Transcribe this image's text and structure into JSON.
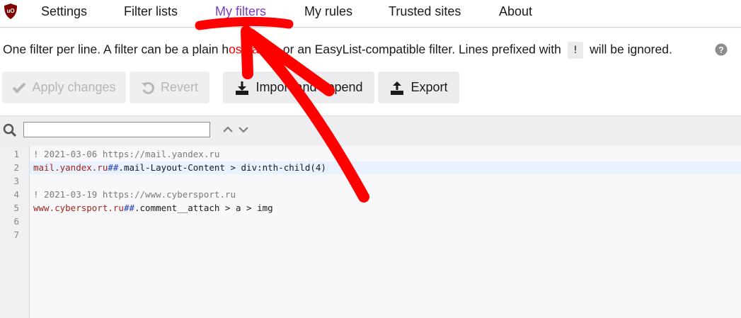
{
  "tabs": [
    {
      "label": "Settings"
    },
    {
      "label": "Filter lists"
    },
    {
      "label": "My filters",
      "active": true
    },
    {
      "label": "My rules"
    },
    {
      "label": "Trusted sites"
    },
    {
      "label": "About"
    }
  ],
  "description": {
    "before": "One filter per line. A filter can be a plain h",
    "hidden_middle_1": "ostnam",
    "after_hidden": "e, or an EasyList-compatible filter. Lines prefixed with",
    "chip": "!",
    "end": "will be ignored."
  },
  "buttons": {
    "apply": "Apply changes",
    "revert": "Revert",
    "import": "Import and append",
    "export": "Export"
  },
  "search": {
    "value": "",
    "placeholder": ""
  },
  "editor": {
    "line_numbers": [
      "1",
      "2",
      "3",
      "4",
      "5",
      "6",
      "7"
    ],
    "lines": [
      {
        "comment": "! 2021-03-06 https://mail.yandex.ru"
      },
      {
        "host": "mail.yandex.ru",
        "sep": "##",
        "rest": ".mail-Layout-Content > div:nth-child(4)"
      },
      {},
      {
        "comment": "! 2021-03-19 https://www.cybersport.ru"
      },
      {
        "host": "www.cybersport.ru",
        "sep": "##",
        "rest": ".comment__attach > a > img"
      },
      {},
      {}
    ]
  },
  "colors": {
    "accent": "#7b3fc2",
    "annotation": "#ff0000",
    "comment": "#7a7a7a",
    "host": "#a0251c",
    "separator": "#1c3bb5"
  },
  "icons": {
    "logo": "ublock-origin-logo",
    "help": "question-circle-icon",
    "apply": "check-icon",
    "revert": "undo-icon",
    "import": "download-icon",
    "export": "upload-icon",
    "search": "magnifier-icon"
  }
}
